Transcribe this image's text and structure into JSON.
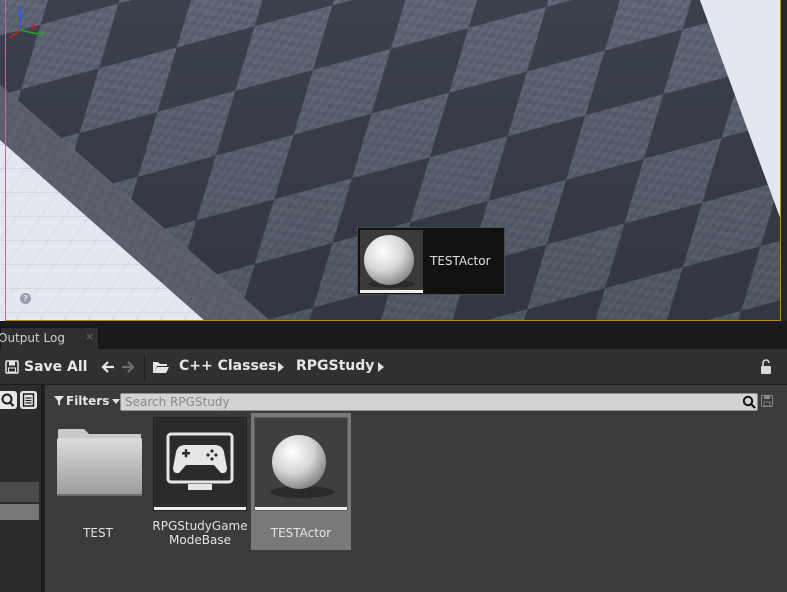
{
  "viewport": {
    "tooltip": {
      "label": "TESTActor"
    },
    "axes": {
      "z": "Z",
      "x": "X",
      "y": "Y"
    },
    "help": "?"
  },
  "tabs": [
    {
      "label": "Output Log",
      "close": "×"
    }
  ],
  "toolbar": {
    "save_all": "Save All",
    "breadcrumb": [
      "C++ Classes",
      "RPGStudy"
    ]
  },
  "assets": {
    "filters_label": "Filters",
    "search_placeholder": "Search RPGStudy",
    "items": [
      {
        "label": "TEST",
        "type": "folder",
        "selected": false
      },
      {
        "label": "RPGStudyGame ModeBase",
        "line1": "RPGStudyGame",
        "line2": "ModeBase",
        "type": "gamemode-class",
        "selected": false
      },
      {
        "label": "TESTActor",
        "type": "actor-class",
        "selected": true
      }
    ]
  },
  "colors": {
    "accent_border": "#b48a18",
    "panel_bg": "#3b3b3b",
    "selected_tile": "#797979",
    "axis_x": "#d02020",
    "axis_y": "#20c020",
    "axis_z": "#2050e0"
  }
}
